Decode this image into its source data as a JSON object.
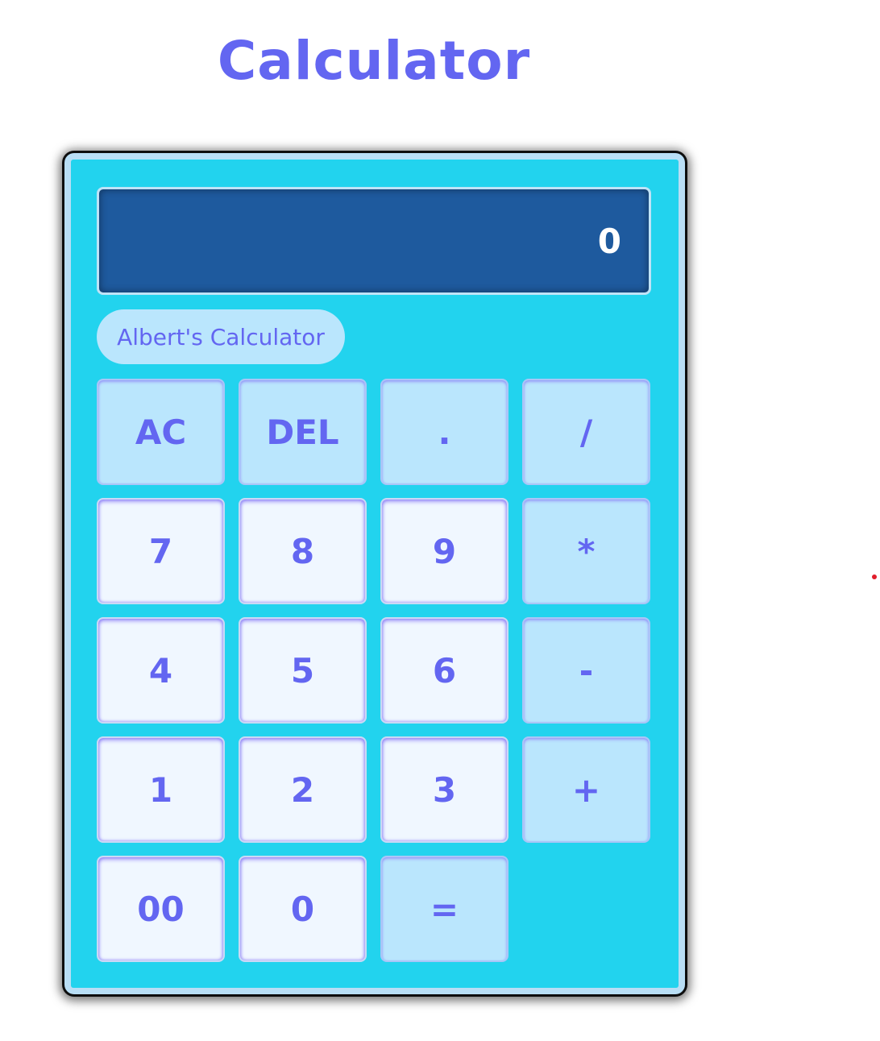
{
  "page": {
    "title": "Calculator"
  },
  "calculator": {
    "display_value": "0",
    "brand_label": "Albert's Calculator",
    "keys": [
      {
        "label": "AC",
        "kind": "op",
        "name": "all-clear-button"
      },
      {
        "label": "DEL",
        "kind": "op",
        "name": "delete-button"
      },
      {
        "label": ".",
        "kind": "op",
        "name": "decimal-button"
      },
      {
        "label": "/",
        "kind": "op",
        "name": "divide-button"
      },
      {
        "label": "7",
        "kind": "num",
        "name": "digit-7-button"
      },
      {
        "label": "8",
        "kind": "num",
        "name": "digit-8-button"
      },
      {
        "label": "9",
        "kind": "num",
        "name": "digit-9-button"
      },
      {
        "label": "*",
        "kind": "op",
        "name": "multiply-button"
      },
      {
        "label": "4",
        "kind": "num",
        "name": "digit-4-button"
      },
      {
        "label": "5",
        "kind": "num",
        "name": "digit-5-button"
      },
      {
        "label": "6",
        "kind": "num",
        "name": "digit-6-button"
      },
      {
        "label": "-",
        "kind": "op",
        "name": "subtract-button"
      },
      {
        "label": "1",
        "kind": "num",
        "name": "digit-1-button"
      },
      {
        "label": "2",
        "kind": "num",
        "name": "digit-2-button"
      },
      {
        "label": "3",
        "kind": "num",
        "name": "digit-3-button"
      },
      {
        "label": "+",
        "kind": "op",
        "name": "add-button"
      },
      {
        "label": "00",
        "kind": "num",
        "name": "double-zero-button"
      },
      {
        "label": "0",
        "kind": "num",
        "name": "digit-0-button"
      },
      {
        "label": "=",
        "kind": "op",
        "name": "equals-button"
      }
    ]
  },
  "colors": {
    "accent": "#6366f1",
    "calculator_body": "#22d3ee",
    "display_background": "#1e5a9e",
    "operator_key": "#bae6fd",
    "number_key": "#f0f7ff",
    "stray_dot": "#e11d2b"
  }
}
